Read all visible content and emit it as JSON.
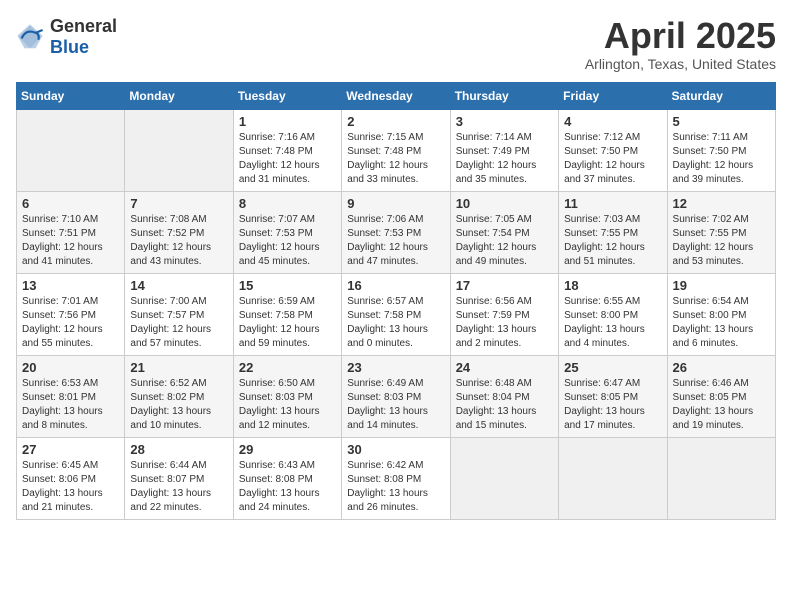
{
  "header": {
    "logo_general": "General",
    "logo_blue": "Blue",
    "title": "April 2025",
    "subtitle": "Arlington, Texas, United States"
  },
  "days_of_week": [
    "Sunday",
    "Monday",
    "Tuesday",
    "Wednesday",
    "Thursday",
    "Friday",
    "Saturday"
  ],
  "weeks": [
    [
      {
        "num": "",
        "empty": true
      },
      {
        "num": "",
        "empty": true
      },
      {
        "num": "1",
        "sunrise": "Sunrise: 7:16 AM",
        "sunset": "Sunset: 7:48 PM",
        "daylight": "Daylight: 12 hours and 31 minutes."
      },
      {
        "num": "2",
        "sunrise": "Sunrise: 7:15 AM",
        "sunset": "Sunset: 7:48 PM",
        "daylight": "Daylight: 12 hours and 33 minutes."
      },
      {
        "num": "3",
        "sunrise": "Sunrise: 7:14 AM",
        "sunset": "Sunset: 7:49 PM",
        "daylight": "Daylight: 12 hours and 35 minutes."
      },
      {
        "num": "4",
        "sunrise": "Sunrise: 7:12 AM",
        "sunset": "Sunset: 7:50 PM",
        "daylight": "Daylight: 12 hours and 37 minutes."
      },
      {
        "num": "5",
        "sunrise": "Sunrise: 7:11 AM",
        "sunset": "Sunset: 7:50 PM",
        "daylight": "Daylight: 12 hours and 39 minutes."
      }
    ],
    [
      {
        "num": "6",
        "sunrise": "Sunrise: 7:10 AM",
        "sunset": "Sunset: 7:51 PM",
        "daylight": "Daylight: 12 hours and 41 minutes."
      },
      {
        "num": "7",
        "sunrise": "Sunrise: 7:08 AM",
        "sunset": "Sunset: 7:52 PM",
        "daylight": "Daylight: 12 hours and 43 minutes."
      },
      {
        "num": "8",
        "sunrise": "Sunrise: 7:07 AM",
        "sunset": "Sunset: 7:53 PM",
        "daylight": "Daylight: 12 hours and 45 minutes."
      },
      {
        "num": "9",
        "sunrise": "Sunrise: 7:06 AM",
        "sunset": "Sunset: 7:53 PM",
        "daylight": "Daylight: 12 hours and 47 minutes."
      },
      {
        "num": "10",
        "sunrise": "Sunrise: 7:05 AM",
        "sunset": "Sunset: 7:54 PM",
        "daylight": "Daylight: 12 hours and 49 minutes."
      },
      {
        "num": "11",
        "sunrise": "Sunrise: 7:03 AM",
        "sunset": "Sunset: 7:55 PM",
        "daylight": "Daylight: 12 hours and 51 minutes."
      },
      {
        "num": "12",
        "sunrise": "Sunrise: 7:02 AM",
        "sunset": "Sunset: 7:55 PM",
        "daylight": "Daylight: 12 hours and 53 minutes."
      }
    ],
    [
      {
        "num": "13",
        "sunrise": "Sunrise: 7:01 AM",
        "sunset": "Sunset: 7:56 PM",
        "daylight": "Daylight: 12 hours and 55 minutes."
      },
      {
        "num": "14",
        "sunrise": "Sunrise: 7:00 AM",
        "sunset": "Sunset: 7:57 PM",
        "daylight": "Daylight: 12 hours and 57 minutes."
      },
      {
        "num": "15",
        "sunrise": "Sunrise: 6:59 AM",
        "sunset": "Sunset: 7:58 PM",
        "daylight": "Daylight: 12 hours and 59 minutes."
      },
      {
        "num": "16",
        "sunrise": "Sunrise: 6:57 AM",
        "sunset": "Sunset: 7:58 PM",
        "daylight": "Daylight: 13 hours and 0 minutes."
      },
      {
        "num": "17",
        "sunrise": "Sunrise: 6:56 AM",
        "sunset": "Sunset: 7:59 PM",
        "daylight": "Daylight: 13 hours and 2 minutes."
      },
      {
        "num": "18",
        "sunrise": "Sunrise: 6:55 AM",
        "sunset": "Sunset: 8:00 PM",
        "daylight": "Daylight: 13 hours and 4 minutes."
      },
      {
        "num": "19",
        "sunrise": "Sunrise: 6:54 AM",
        "sunset": "Sunset: 8:00 PM",
        "daylight": "Daylight: 13 hours and 6 minutes."
      }
    ],
    [
      {
        "num": "20",
        "sunrise": "Sunrise: 6:53 AM",
        "sunset": "Sunset: 8:01 PM",
        "daylight": "Daylight: 13 hours and 8 minutes."
      },
      {
        "num": "21",
        "sunrise": "Sunrise: 6:52 AM",
        "sunset": "Sunset: 8:02 PM",
        "daylight": "Daylight: 13 hours and 10 minutes."
      },
      {
        "num": "22",
        "sunrise": "Sunrise: 6:50 AM",
        "sunset": "Sunset: 8:03 PM",
        "daylight": "Daylight: 13 hours and 12 minutes."
      },
      {
        "num": "23",
        "sunrise": "Sunrise: 6:49 AM",
        "sunset": "Sunset: 8:03 PM",
        "daylight": "Daylight: 13 hours and 14 minutes."
      },
      {
        "num": "24",
        "sunrise": "Sunrise: 6:48 AM",
        "sunset": "Sunset: 8:04 PM",
        "daylight": "Daylight: 13 hours and 15 minutes."
      },
      {
        "num": "25",
        "sunrise": "Sunrise: 6:47 AM",
        "sunset": "Sunset: 8:05 PM",
        "daylight": "Daylight: 13 hours and 17 minutes."
      },
      {
        "num": "26",
        "sunrise": "Sunrise: 6:46 AM",
        "sunset": "Sunset: 8:05 PM",
        "daylight": "Daylight: 13 hours and 19 minutes."
      }
    ],
    [
      {
        "num": "27",
        "sunrise": "Sunrise: 6:45 AM",
        "sunset": "Sunset: 8:06 PM",
        "daylight": "Daylight: 13 hours and 21 minutes."
      },
      {
        "num": "28",
        "sunrise": "Sunrise: 6:44 AM",
        "sunset": "Sunset: 8:07 PM",
        "daylight": "Daylight: 13 hours and 22 minutes."
      },
      {
        "num": "29",
        "sunrise": "Sunrise: 6:43 AM",
        "sunset": "Sunset: 8:08 PM",
        "daylight": "Daylight: 13 hours and 24 minutes."
      },
      {
        "num": "30",
        "sunrise": "Sunrise: 6:42 AM",
        "sunset": "Sunset: 8:08 PM",
        "daylight": "Daylight: 13 hours and 26 minutes."
      },
      {
        "num": "",
        "empty": true
      },
      {
        "num": "",
        "empty": true
      },
      {
        "num": "",
        "empty": true
      }
    ]
  ]
}
